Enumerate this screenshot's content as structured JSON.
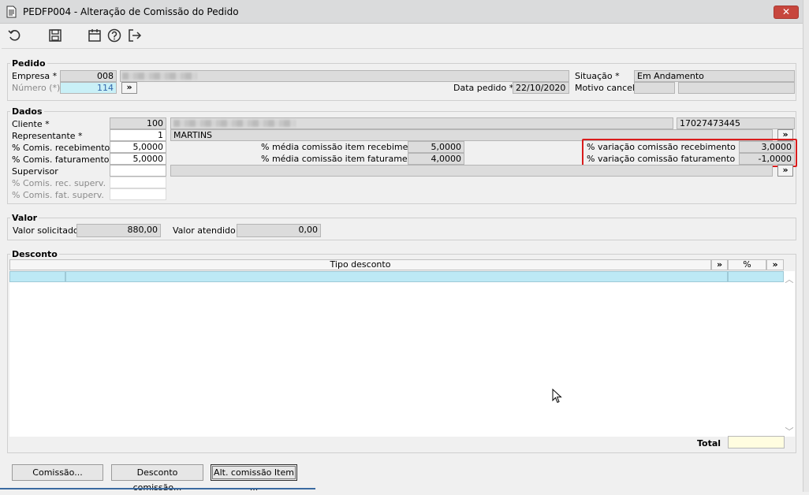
{
  "window": {
    "title": "PEDFP004 - Alteração de Comissão do Pedido",
    "close_glyph": "✕"
  },
  "toolbar": {
    "icons": [
      "undo-icon",
      "save-icon",
      "calendar-icon",
      "help-icon",
      "exit-icon"
    ]
  },
  "pedido": {
    "legend": "Pedido",
    "empresa_label": "Empresa *",
    "empresa_value": "008",
    "numero_label": "Número (*)",
    "numero_value": "114",
    "lookup_glyph": "»",
    "data_label": "Data pedido *",
    "data_value": "22/10/2020",
    "situacao_label": "Situação *",
    "situacao_value": "Em Andamento",
    "motivo_label": "Motivo cancel."
  },
  "dados": {
    "legend": "Dados",
    "cliente_label": "Cliente *",
    "cliente_value": "100",
    "cliente_doc": "17027473445",
    "representante_label": "Representante *",
    "representante_value": "1",
    "representante_name": "MARTINS",
    "comis_receb_label": "% Comis. recebimento",
    "comis_receb_value": "5,0000",
    "comis_fat_label": "% Comis. faturamento",
    "comis_fat_value": "5,0000",
    "supervisor_label": "Supervisor",
    "comis_rec_superv_label": "% Comis. rec. superv.",
    "comis_fat_superv_label": "% Comis. fat. superv.",
    "media_receb_label": "% média comissão item recebimento",
    "media_receb_value": "5,0000",
    "media_fat_label": "% média comissão item faturamento",
    "media_fat_value": "4,0000",
    "var_receb_label": "% variação comissão recebimento",
    "var_receb_value": "3,0000",
    "var_fat_label": "% variação comissão faturamento",
    "var_fat_value": "-1,0000",
    "lookup_glyph": "»"
  },
  "valor": {
    "legend": "Valor",
    "solicitado_label": "Valor solicitado",
    "solicitado_value": "880,00",
    "atendido_label": "Valor atendido",
    "atendido_value": "0,00"
  },
  "desconto": {
    "legend": "Desconto",
    "columns": [
      "Tipo desconto",
      "%"
    ],
    "expand_glyph": "»",
    "total_label": "Total",
    "total_value": ""
  },
  "footer": {
    "buttons": [
      "Comissão...",
      "Desconto comissão...",
      "Alt. comissão Item ..."
    ]
  }
}
